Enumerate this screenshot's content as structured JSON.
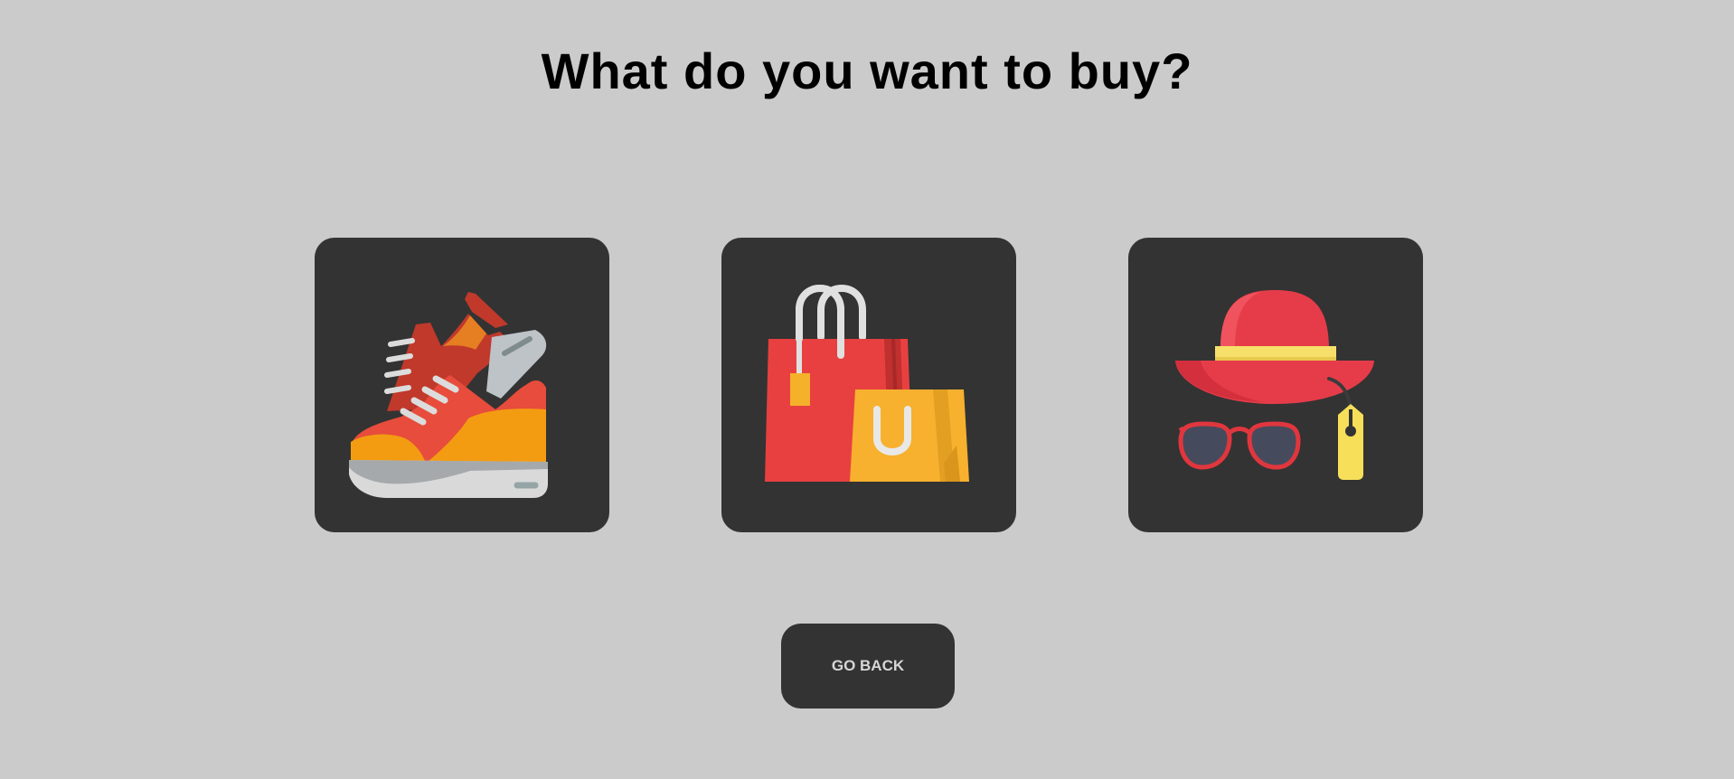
{
  "page": {
    "title": "What do you want to buy?"
  },
  "categories": [
    {
      "icon": "sneakers-icon"
    },
    {
      "icon": "shopping-bags-icon"
    },
    {
      "icon": "hat-sunglasses-tag-icon"
    }
  ],
  "actions": {
    "go_back_label": "GO BACK"
  },
  "colors": {
    "background": "#cbcbcb",
    "card": "#333333",
    "title": "#000000",
    "button_text": "#d6d6d6",
    "red": "#e84c3d",
    "orange": "#f39c12",
    "yellow": "#f9e05a"
  }
}
